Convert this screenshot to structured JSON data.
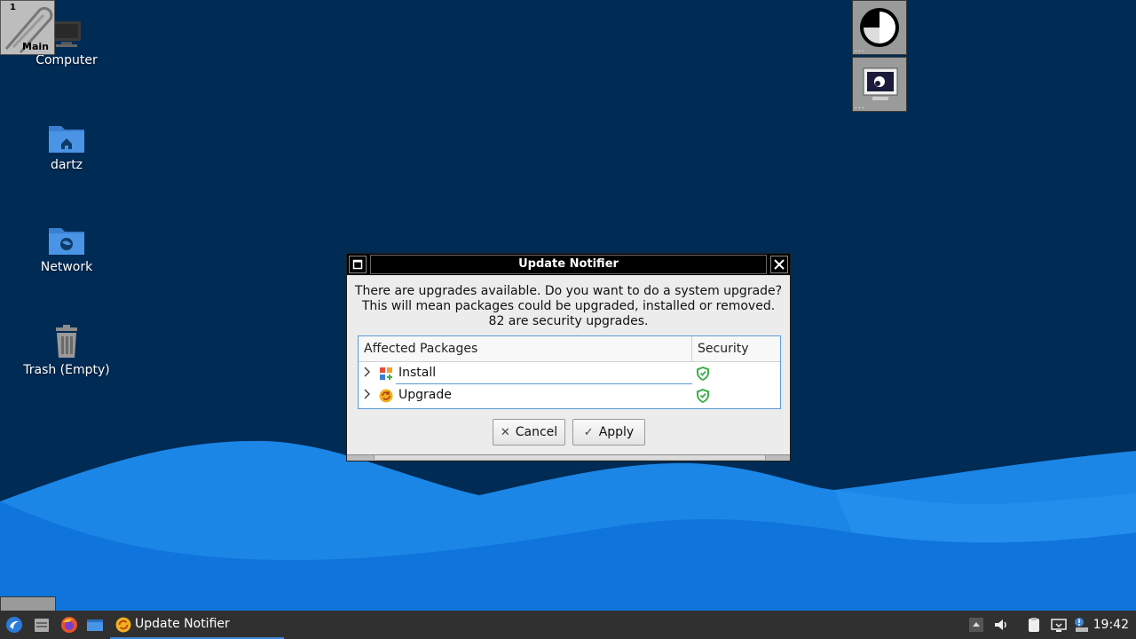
{
  "desktop": {
    "icons": [
      {
        "label": "Computer",
        "icon": "computer-icon"
      },
      {
        "label": "dartz",
        "icon": "home-folder-icon"
      },
      {
        "label": "Network",
        "icon": "network-folder-icon"
      },
      {
        "label": "Trash (Empty)",
        "icon": "trash-icon"
      }
    ],
    "pager": {
      "number": "1",
      "name": "Main"
    }
  },
  "dialog": {
    "title": "Update Notifier",
    "message_lines": [
      "There are upgrades available. Do you want to do a system upgrade?",
      "This will mean packages could be upgraded, installed or removed.",
      "82 are security upgrades."
    ],
    "columns": {
      "packages": "Affected Packages",
      "security": "Security"
    },
    "rows": [
      {
        "label": "Install",
        "icon": "install-package-icon",
        "security_icon": "shield-check-icon"
      },
      {
        "label": "Upgrade",
        "icon": "upgrade-package-icon",
        "security_icon": "shield-check-icon"
      }
    ],
    "buttons": {
      "cancel": "Cancel",
      "apply": "Apply"
    }
  },
  "taskbar": {
    "task_label": "Update Notifier",
    "clock": "19:42"
  },
  "colors": {
    "desktop_bg": "#002b55",
    "wave_light": "#1e90ee",
    "wave_dark": "#0a6fd6",
    "accent": "#3d86d8",
    "shield": "#3aae4a"
  }
}
